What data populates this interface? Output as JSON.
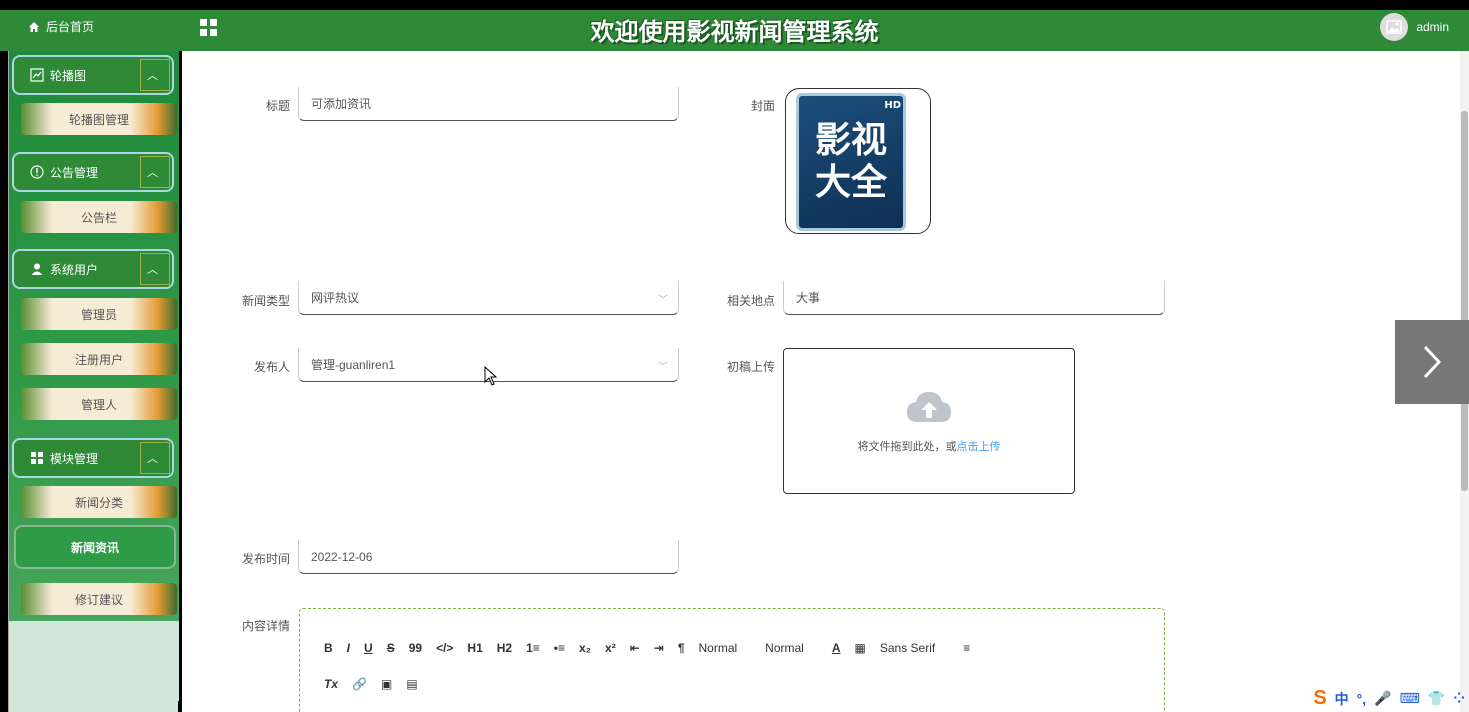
{
  "header": {
    "home_label": "后台首页",
    "title": "欢迎使用影视新闻管理系统",
    "user": "admin"
  },
  "sidebar": {
    "groups": [
      {
        "label": "轮播图",
        "items": [
          "轮播图管理"
        ]
      },
      {
        "label": "公告管理",
        "items": [
          "公告栏"
        ]
      },
      {
        "label": "系统用户",
        "items": [
          "管理员",
          "注册用户",
          "管理人"
        ]
      },
      {
        "label": "模块管理",
        "items": [
          "新闻分类",
          "新闻资讯",
          "修订建议"
        ]
      }
    ],
    "active_item": "新闻资讯"
  },
  "form": {
    "title_label": "标题",
    "title_value": "可添加资讯",
    "cover_label": "封面",
    "cover_text_top": "影视",
    "cover_text_bottom": "大全",
    "cover_hd": "HD",
    "type_label": "新闻类型",
    "type_value": "网评热议",
    "location_label": "相关地点",
    "location_value": "大事",
    "publisher_label": "发布人",
    "publisher_value": "管理-guanliren1",
    "draft_label": "初稿上传",
    "upload_text": "将文件拖到此处，或",
    "upload_link": "点击上传",
    "publish_time_label": "发布时间",
    "publish_time_value": "2022-12-06",
    "content_label": "内容详情"
  },
  "editor": {
    "toolbar_row1": [
      "B",
      "I",
      "U",
      "S",
      "99",
      "</>",
      "H1",
      "H2",
      "1≡",
      "•≡",
      "x₂",
      "x²",
      "⇤",
      "⇥",
      "¶",
      "Normal",
      "Normal",
      "A",
      "▦",
      "Sans Serif",
      "≡"
    ],
    "toolbar_row2": [
      "Tx",
      "🔗",
      "▣",
      "▤"
    ]
  },
  "ime": {
    "items": [
      "S",
      "中",
      "°,",
      "🎤",
      "⌨",
      "👕",
      "⁘"
    ]
  },
  "colors": {
    "primary_green": "#2e8a36",
    "link_blue": "#409eff"
  }
}
